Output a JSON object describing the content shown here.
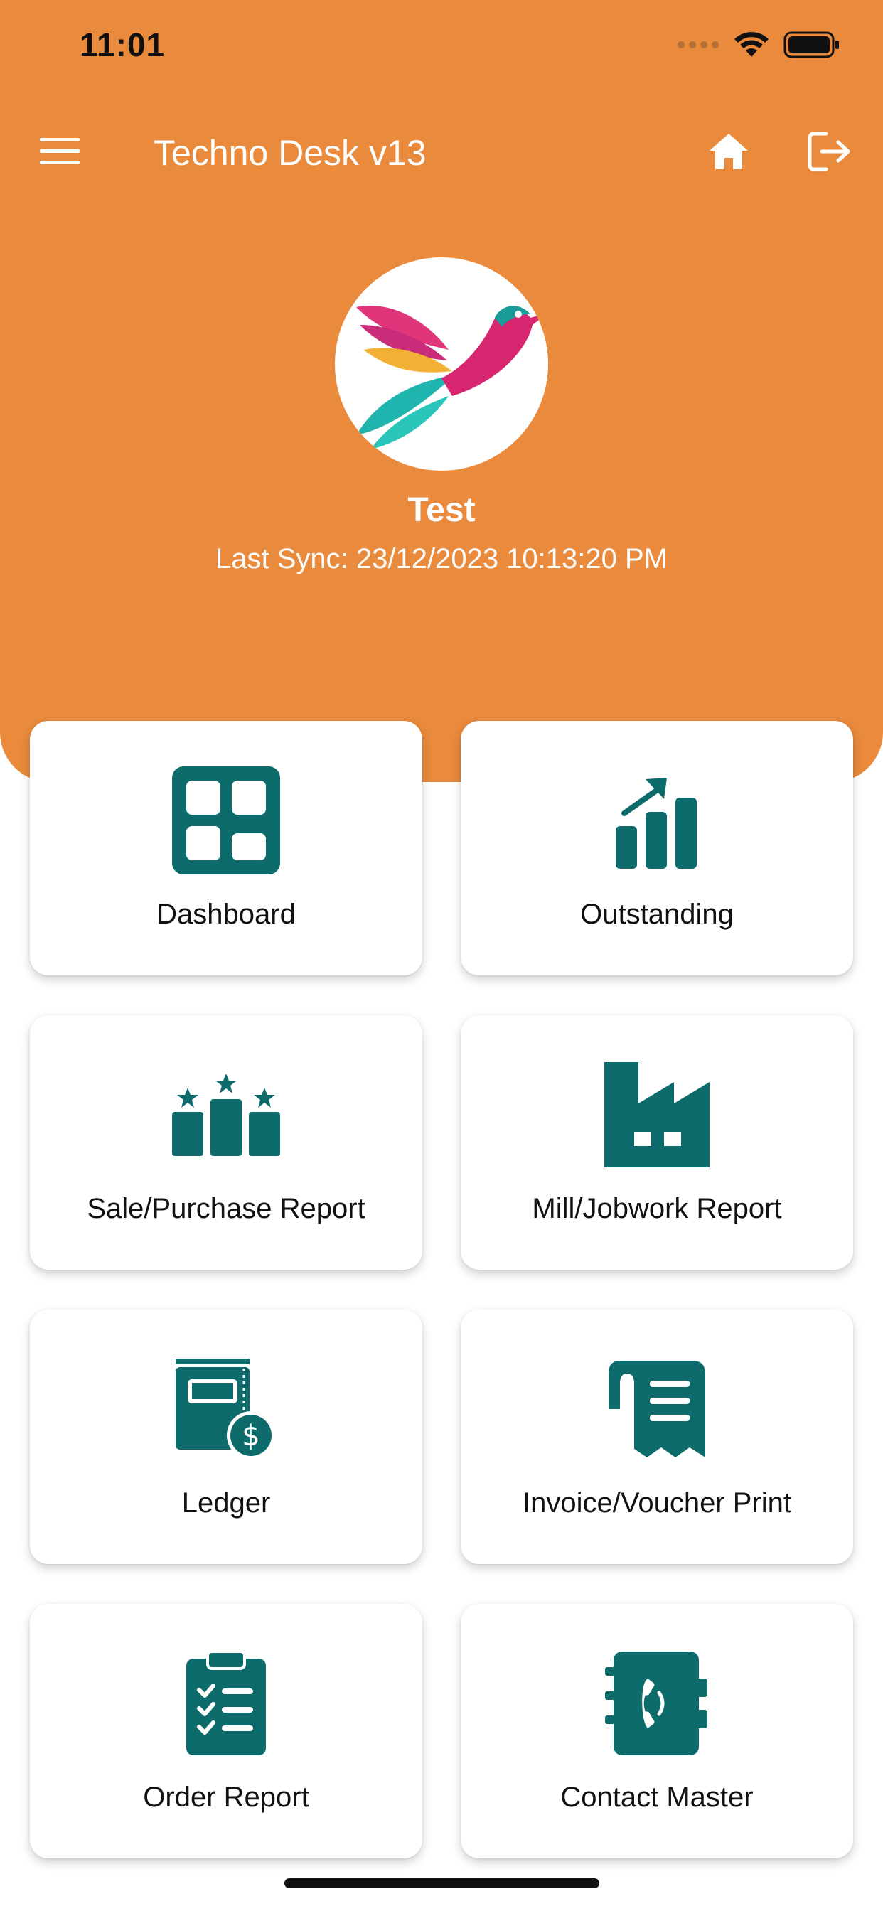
{
  "status_bar": {
    "time": "11:01"
  },
  "app_bar": {
    "title": "Techno Desk v13",
    "menu_icon": "hamburger-menu-icon",
    "home_icon": "home-icon",
    "logout_icon": "logout-icon"
  },
  "profile": {
    "name": "Test",
    "last_sync": "Last Sync: 23/12/2023 10:13:20 PM"
  },
  "tiles": [
    {
      "label": "Dashboard",
      "icon": "dashboard-grid-icon"
    },
    {
      "label": "Outstanding",
      "icon": "growth-chart-icon"
    },
    {
      "label": "Sale/Purchase Report",
      "icon": "podium-stars-icon"
    },
    {
      "label": "Mill/Jobwork Report",
      "icon": "factory-icon"
    },
    {
      "label": "Ledger",
      "icon": "ledger-book-dollar-icon"
    },
    {
      "label": "Invoice/Voucher Print",
      "icon": "receipt-icon"
    },
    {
      "label": "Order Report",
      "icon": "clipboard-checklist-icon"
    },
    {
      "label": "Contact Master",
      "icon": "contact-book-phone-icon"
    }
  ],
  "colors": {
    "header": "#E98A3C",
    "icon_teal": "#0E6B6B",
    "tile_background": "#FFFFFF"
  }
}
